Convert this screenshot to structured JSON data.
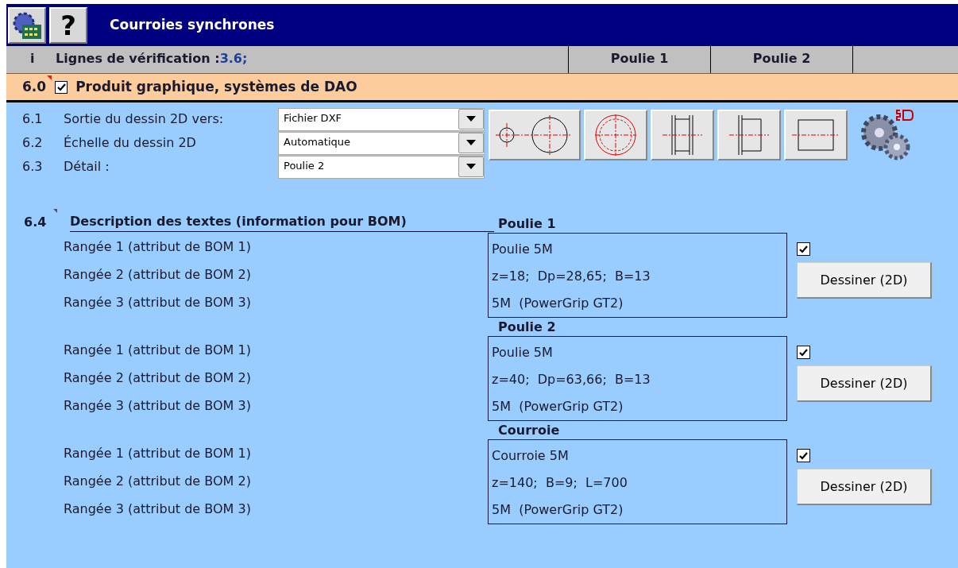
{
  "window": {
    "title": "Courroies synchrones",
    "help_button": "?"
  },
  "header": {
    "info": "i",
    "label": "Lignes de vérification :",
    "value": "3.6;",
    "columns": [
      "Poulie 1",
      "Poulie 2"
    ]
  },
  "section": {
    "number": "6.0",
    "checked": true,
    "title": "Produit graphique, systèmes de DAO"
  },
  "settings": [
    {
      "number": "6.1",
      "label": "Sortie du dessin 2D vers:",
      "value": "Fichier DXF"
    },
    {
      "number": "6.2",
      "label": "Échelle du dessin 2D",
      "value": "Automatique"
    },
    {
      "number": "6.3",
      "label": "Détail :",
      "value": "Poulie 2"
    }
  ],
  "bom": {
    "number": "6.4",
    "title": "Description des textes (information pour BOM)",
    "groups": [
      {
        "title": "Poulie 1",
        "checked": true,
        "button": "Dessiner (2D)",
        "rows": [
          {
            "label": "Rangée 1 (attribut de BOM 1)",
            "value": "Poulie 5M"
          },
          {
            "label": "Rangée 2 (attribut de BOM 2)",
            "value": "z=18;  Dp=28,65;  B=13"
          },
          {
            "label": "Rangée 3 (attribut de BOM 3)",
            "value": "5M  (PowerGrip GT2)"
          }
        ]
      },
      {
        "title": "Poulie 2",
        "checked": true,
        "button": "Dessiner (2D)",
        "rows": [
          {
            "label": "Rangée 1 (attribut de BOM 1)",
            "value": "Poulie 5M"
          },
          {
            "label": "Rangée 2 (attribut de BOM 2)",
            "value": "z=40;  Dp=63,66;  B=13"
          },
          {
            "label": "Rangée 3 (attribut de BOM 3)",
            "value": "5M  (PowerGrip GT2)"
          }
        ]
      },
      {
        "title": "Courroie",
        "checked": true,
        "button": "Dessiner (2D)",
        "rows": [
          {
            "label": "Rangée 1 (attribut de BOM 1)",
            "value": "Courroie 5M"
          },
          {
            "label": "Rangée 2 (attribut de BOM 2)",
            "value": "z=140;  B=9;  L=700"
          },
          {
            "label": "Rangée 3 (attribut de BOM 3)",
            "value": "5M  (PowerGrip GT2)"
          }
        ]
      }
    ]
  }
}
